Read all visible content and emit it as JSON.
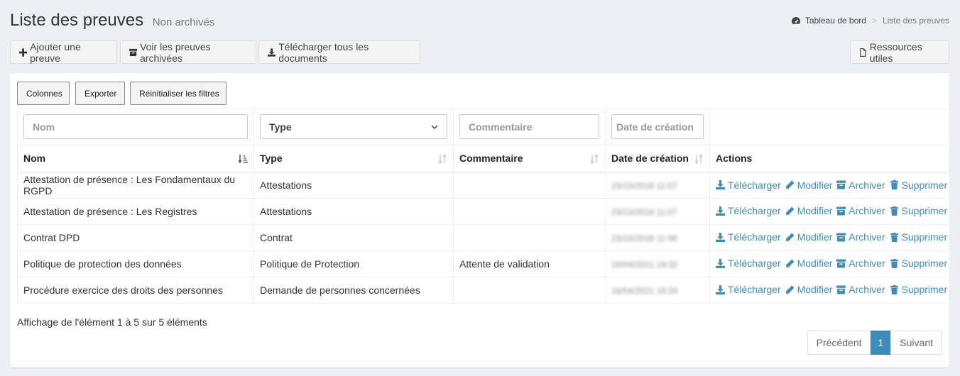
{
  "header": {
    "title": "Liste des preuves",
    "subtitle": "Non archivés",
    "breadcrumb": {
      "home": "Tableau de bord",
      "current": "Liste des preuves"
    }
  },
  "toolbar": {
    "add": "Ajouter une preuve",
    "archived": "Voir les preuves archivées",
    "download_all": "Télécharger tous les documents",
    "resources": "Ressources utiles"
  },
  "table_tools": {
    "columns": "Colonnes",
    "export": "Exporter",
    "reset": "Réinitialiser les filtres"
  },
  "filters": {
    "name_placeholder": "Nom",
    "type_selected": "Type",
    "comment_placeholder": "Commentaire",
    "date_placeholder": "Date de création"
  },
  "columns": [
    "Nom",
    "Type",
    "Commentaire",
    "Date de création",
    "Actions"
  ],
  "rows": [
    {
      "name": "Attestation de présence : Les Fondamentaux du RGPD",
      "type": "Attestations",
      "comment": "",
      "date": "23/10/2018 11:07"
    },
    {
      "name": "Attestation de présence : Les Registres",
      "type": "Attestations",
      "comment": "",
      "date": "23/10/2018 11:07"
    },
    {
      "name": "Contrat DPD",
      "type": "Contrat",
      "comment": "",
      "date": "23/10/2018 11:08"
    },
    {
      "name": "Politique de protection des données",
      "type": "Politique de Protection",
      "comment": "Attente de validation",
      "date": "16/04/2021 18:32"
    },
    {
      "name": "Procédure exercice des droits des personnes",
      "type": "Demande de personnes concernées",
      "comment": "",
      "date": "16/04/2021 18:34"
    }
  ],
  "actions": {
    "download": "Télécharger",
    "edit": "Modifier",
    "archive": "Archiver",
    "delete": "Supprimer"
  },
  "info": "Affichage de l'élément 1 à 5 sur 5 éléments",
  "pagination": {
    "prev": "Précédent",
    "current": "1",
    "next": "Suivant"
  },
  "colors": {
    "link": "#3c8dbc",
    "active_page": "#3c8dbc",
    "background": "#ecf0f5"
  }
}
